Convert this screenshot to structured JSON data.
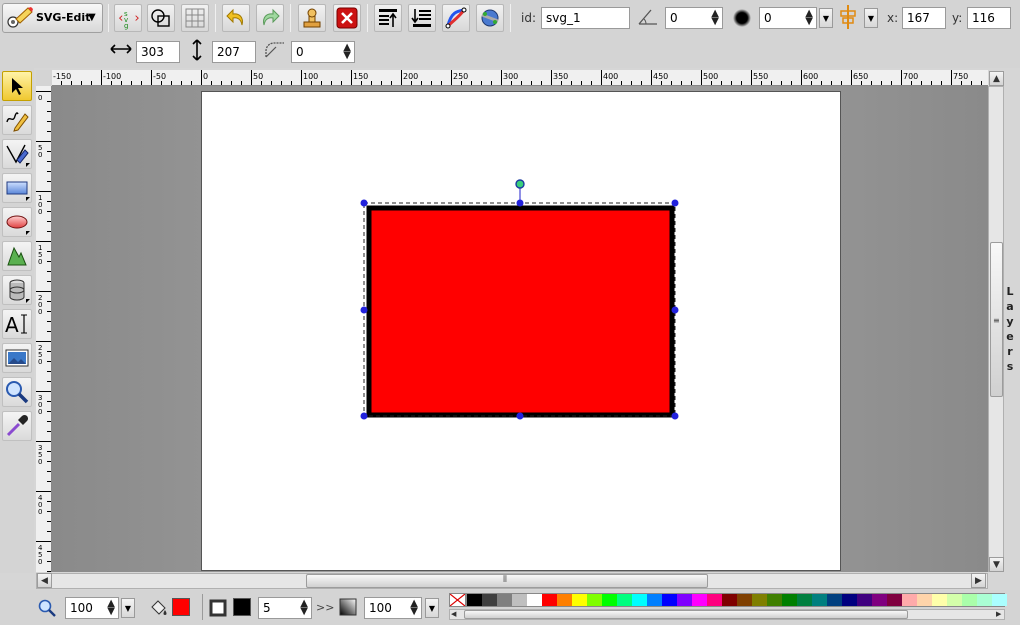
{
  "app": {
    "menu_label": "SVG-Edit"
  },
  "toolbar": {
    "id_label": "id:",
    "id_value": "svg_1",
    "angle_value": "0",
    "blur_value": "0",
    "x_label": "x:",
    "x_value": "167",
    "y_label": "y:",
    "y_value": "116",
    "width_value": "303",
    "height_value": "207",
    "radius_value": "0"
  },
  "tools": [
    "select-tool",
    "pencil-tool",
    "path-tool",
    "rect-tool",
    "ellipse-tool",
    "polygon-tool",
    "shapelib-tool",
    "text-tool",
    "image-tool",
    "zoom-tool",
    "eyedropper-tool"
  ],
  "rulers": {
    "x_labels": [
      "-150",
      "-100",
      "-50",
      "0",
      "50",
      "100",
      "150",
      "200",
      "250",
      "300",
      "350",
      "400",
      "450",
      "500",
      "550",
      "600",
      "650",
      "700",
      "750"
    ],
    "y_labels": [
      "0",
      "50",
      "100",
      "150",
      "200",
      "250",
      "300",
      "350",
      "400",
      "450"
    ]
  },
  "layers_tab_label": "Layers",
  "bottom": {
    "zoom_value": "100",
    "fill_color": "#ff0000",
    "stroke_color": "#000000",
    "stroke_width": "5",
    "more_label": ">>",
    "opacity_value": "100"
  },
  "shape": {
    "fill": "#ff0000",
    "stroke": "#000000"
  },
  "palette": [
    "#000000",
    "#3f3f3f",
    "#7f7f7f",
    "#bfbfbf",
    "#ffffff",
    "#ff0000",
    "#ff7f00",
    "#ffff00",
    "#7fff00",
    "#00ff00",
    "#00ff7f",
    "#00ffff",
    "#007fff",
    "#0000ff",
    "#7f00ff",
    "#ff00ff",
    "#ff007f",
    "#7f0000",
    "#7f3f00",
    "#7f7f00",
    "#3f7f00",
    "#007f00",
    "#007f3f",
    "#007f7f",
    "#003f7f",
    "#00007f",
    "#3f007f",
    "#7f007f",
    "#7f003f",
    "#ffaaaa",
    "#ffd4aa",
    "#ffffaa",
    "#d4ffaa",
    "#aaffaa",
    "#aaffd4",
    "#aaffff"
  ]
}
